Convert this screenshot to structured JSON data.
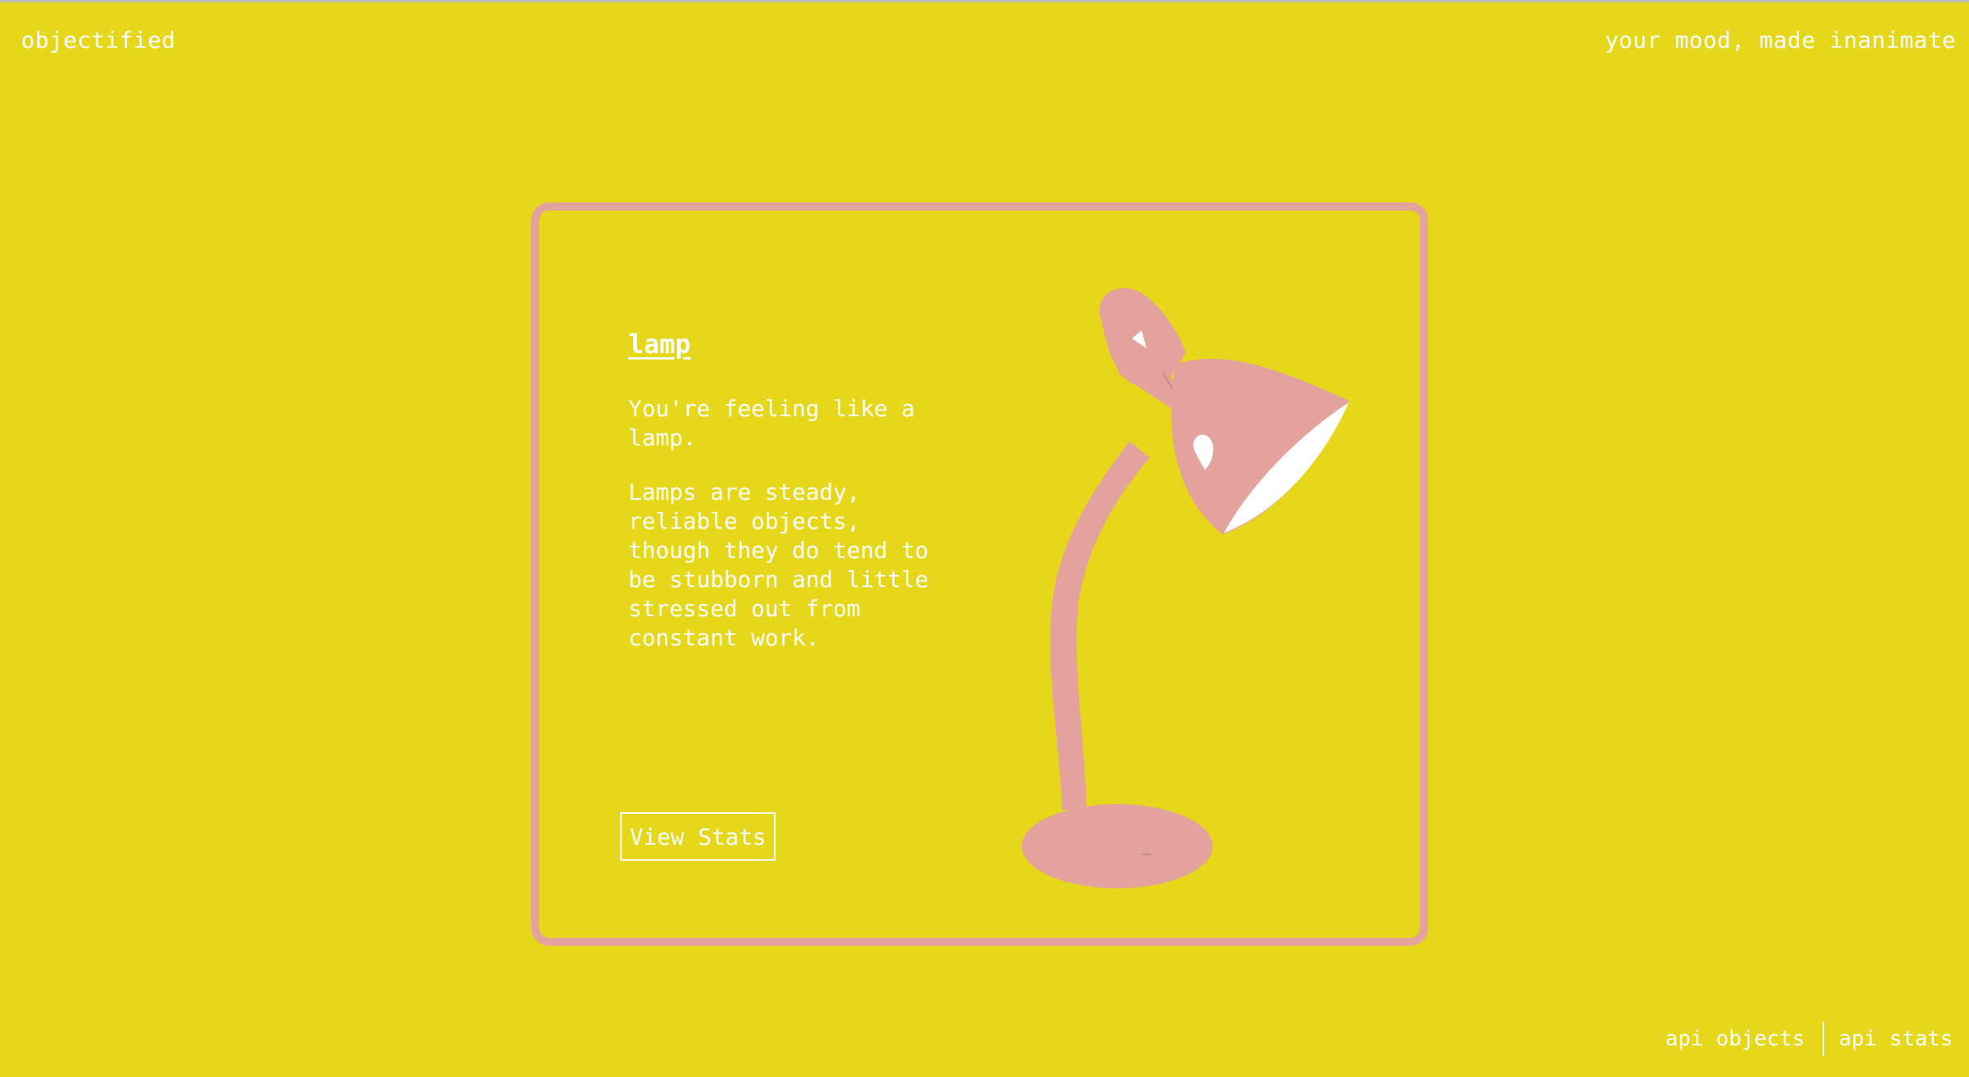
{
  "header": {
    "brand": "objectified",
    "tagline": "your mood, made inanimate"
  },
  "object": {
    "name": "lamp",
    "intro": "You're feeling like a lamp.",
    "description": "Lamps are steady, reliable objects, though they do tend to be stubborn and little stressed out from constant work.",
    "image_icon": "desk-lamp-illustration"
  },
  "card": {
    "stats_button": "View Stats"
  },
  "footer": {
    "links": [
      "api objects",
      "api stats"
    ]
  },
  "colors": {
    "background": "#E6D71A",
    "accent": "#E4A29D",
    "text": "#FFFFFF"
  }
}
